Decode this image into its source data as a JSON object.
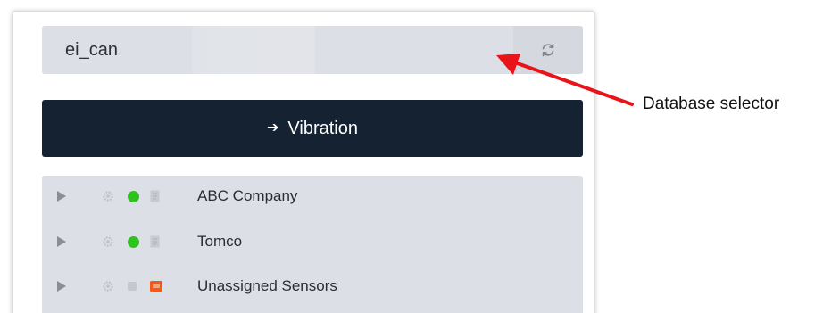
{
  "database": {
    "selected": "ei_can",
    "refresh_icon": "refresh-icon"
  },
  "vibration_button": {
    "label": "Vibration",
    "icon": "arrow-right-icon"
  },
  "tree": {
    "items": [
      {
        "label": "ABC Company",
        "status_color": "#2ec21e",
        "type_icon": "doc-icon"
      },
      {
        "label": "Tomco",
        "status_color": "#2ec21e",
        "type_icon": "doc-icon"
      },
      {
        "label": "Unassigned Sensors",
        "status_color": "#c4c7cd",
        "type_icon": "folder-alert-icon",
        "type_color": "#f05a1a"
      }
    ]
  },
  "annotation": {
    "label": "Database selector",
    "arrow_color": "#e8141a"
  },
  "colors": {
    "button_bg": "#152232",
    "panel_bg": "#dcdfe6",
    "online": "#2ec21e"
  }
}
